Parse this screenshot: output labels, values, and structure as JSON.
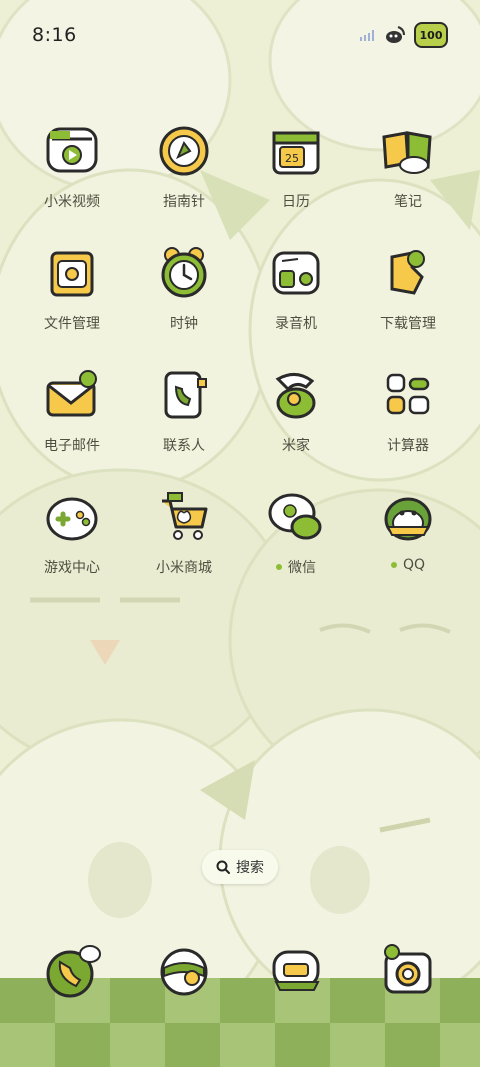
{
  "status": {
    "time": "8:16",
    "battery": "100"
  },
  "apps": [
    {
      "label": "小米视频",
      "icon": "video-icon"
    },
    {
      "label": "指南针",
      "icon": "compass-icon"
    },
    {
      "label": "日历",
      "icon": "calendar-icon",
      "date": "25"
    },
    {
      "label": "笔记",
      "icon": "notes-icon"
    },
    {
      "label": "文件管理",
      "icon": "folder-icon"
    },
    {
      "label": "时钟",
      "icon": "clock-icon"
    },
    {
      "label": "录音机",
      "icon": "recorder-icon"
    },
    {
      "label": "下载管理",
      "icon": "download-icon"
    },
    {
      "label": "电子邮件",
      "icon": "mail-icon"
    },
    {
      "label": "联系人",
      "icon": "contacts-icon"
    },
    {
      "label": "米家",
      "icon": "mijia-icon"
    },
    {
      "label": "计算器",
      "icon": "calculator-icon"
    },
    {
      "label": "游戏中心",
      "icon": "gamepad-icon"
    },
    {
      "label": "小米商城",
      "icon": "shopping-cart-icon"
    },
    {
      "label": "微信",
      "icon": "wechat-icon",
      "new": true
    },
    {
      "label": "QQ",
      "icon": "qq-penguin-icon",
      "new": true
    }
  ],
  "search": {
    "label": "搜索"
  },
  "dock": [
    {
      "icon": "phone-icon"
    },
    {
      "icon": "browser-globe-icon"
    },
    {
      "icon": "messages-icon"
    },
    {
      "icon": "camera-icon"
    }
  ],
  "colors": {
    "accent": "#8dbd35",
    "wallpaper": "#eef0d6",
    "outline": "#2a2a2a",
    "dock_dark": "#8fb05a",
    "dock_light": "#a8c476"
  }
}
